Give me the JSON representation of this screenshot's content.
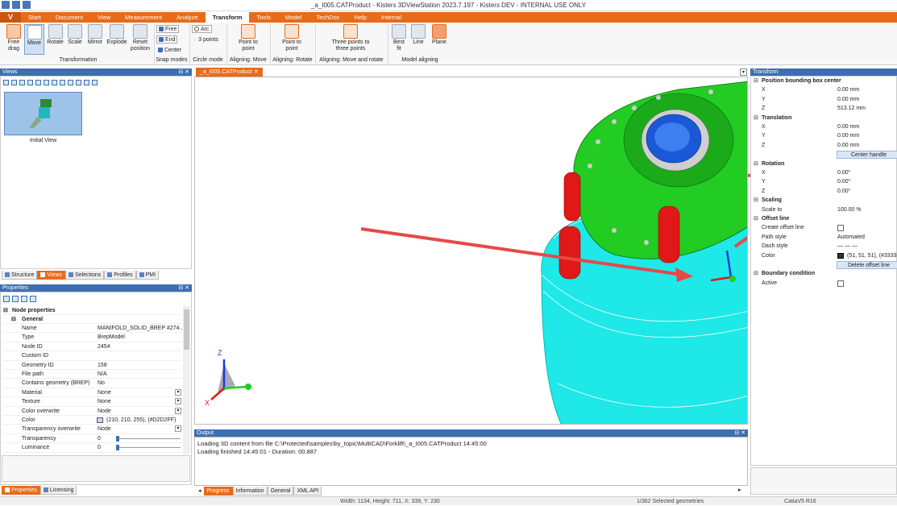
{
  "window": {
    "title": "_a_I005.CATProduct - Kisters 3DViewStation 2023.7.197 - Kisters DEV - INTERNAL USE ONLY"
  },
  "menu": {
    "logo": "V",
    "items": [
      "Start",
      "Document",
      "View",
      "Measurement",
      "Analyze",
      "Transform",
      "Tools",
      "Model",
      "TechDoc",
      "Help",
      "Internal"
    ],
    "active": "Transform"
  },
  "ribbon": {
    "transformation": {
      "label": "Transformation",
      "buttons": [
        "Free\ndrag",
        "Move",
        "Rotate",
        "Scale",
        "Mirror",
        "Explode",
        "Reset\nposition"
      ]
    },
    "snap": {
      "label": "Snap modes",
      "free": "Free",
      "end": "End",
      "center": "Center"
    },
    "circle": {
      "label": "Circle mode",
      "arc": "Arc",
      "three": "3 points"
    },
    "align_move": {
      "label": "Aligning: Move",
      "btn": "Point to\npoint"
    },
    "align_rotate": {
      "label": "Aligning: Rotate",
      "btn": "Point to\npoint"
    },
    "align_both": {
      "label": "Aligning: Move and rotate",
      "btn": "Three points to\nthree points"
    },
    "model_align": {
      "label": "Model aligning",
      "buttons": [
        "Best\nfit",
        "Line",
        "Plane"
      ]
    }
  },
  "views": {
    "title": "Views",
    "thumb_label": "Initial View",
    "tabs": [
      "Structure",
      "Views",
      "Selections",
      "Profiles",
      "PMI"
    ],
    "active_tab": "Views"
  },
  "properties": {
    "title": "Properties",
    "node_header": "Node properties",
    "general_header": "General",
    "rows": [
      {
        "k": "Name",
        "v": "MANIFOLD_SOLID_BREP #274..."
      },
      {
        "k": "Type",
        "v": "BrepModel"
      },
      {
        "k": "Node ID",
        "v": "2454"
      },
      {
        "k": "Custom ID",
        "v": ""
      },
      {
        "k": "Geometry ID",
        "v": "158"
      },
      {
        "k": "File path",
        "v": "N/A"
      },
      {
        "k": "Contains geometry (BREP)",
        "v": "No"
      },
      {
        "k": "Material",
        "v": "None"
      },
      {
        "k": "Texture",
        "v": "None"
      },
      {
        "k": "Color overwrite",
        "v": "Node"
      },
      {
        "k": "Color",
        "v": "(210, 210, 255), (#D2D2FF)"
      },
      {
        "k": "Transparency overwrite",
        "v": "Node"
      },
      {
        "k": "Transparency",
        "v": "0"
      },
      {
        "k": "Luminance",
        "v": "0"
      }
    ],
    "tabs": [
      "Properties",
      "Licensing"
    ],
    "active_tab": "Properties"
  },
  "document": {
    "tab": "_a_I005.CATProduct"
  },
  "output": {
    "title": "Output",
    "lines": [
      "Loading 3D content from file C:\\Protected\\samples\\by_topic\\MultiCAD\\Forklift\\_a_I005.CATProduct 14:45:00",
      "Loading finished 14:45:01 - Duration: 00.887"
    ],
    "tabs": [
      "Progress",
      "Information",
      "General",
      "XML API"
    ],
    "active_tab": "Progress"
  },
  "axes": {
    "z": "Z",
    "x": "X"
  },
  "transform": {
    "title": "Transform",
    "pos_header": "Position bounding box center",
    "pos": [
      {
        "k": "X",
        "v": "0.00 mm"
      },
      {
        "k": "Y",
        "v": "0.00 mm"
      },
      {
        "k": "Z",
        "v": "513.12 mm"
      }
    ],
    "trans_header": "Translation",
    "trans": [
      {
        "k": "X",
        "v": "0.00 mm"
      },
      {
        "k": "Y",
        "v": "0.00 mm"
      },
      {
        "k": "Z",
        "v": "0.00 mm"
      }
    ],
    "center_handle": "Center handle",
    "rot_header": "Rotation",
    "rot": [
      {
        "k": "X",
        "v": "0.00°"
      },
      {
        "k": "Y",
        "v": "0.00°"
      },
      {
        "k": "Z",
        "v": "0.00°"
      }
    ],
    "scale_header": "Scaling",
    "scale": {
      "k": "Scale to",
      "v": "100.00 %"
    },
    "offset_header": "Offset line",
    "offset": [
      {
        "k": "Create offset line",
        "v": ""
      },
      {
        "k": "Path style",
        "v": "Automated"
      },
      {
        "k": "Dash style",
        "v": "— — —"
      },
      {
        "k": "Color",
        "v": "(51, 51, 51), (#333333)"
      }
    ],
    "delete_offset": "Delete offset line",
    "boundary_header": "Boundary condition",
    "boundary": {
      "k": "Active",
      "v": ""
    }
  },
  "status": {
    "size": "Width: 1134, Height: 711, X: 339, Y: 230",
    "selected": "1/362 Selected geometries",
    "format": "CatiaV5 R16"
  },
  "colors": {
    "accent": "#e86b1a",
    "panel_head": "#3d6fb0",
    "model_green": "#22cc22",
    "model_cyan": "#1ee8e8",
    "model_red": "#e01818",
    "arrow": "#e84848"
  }
}
